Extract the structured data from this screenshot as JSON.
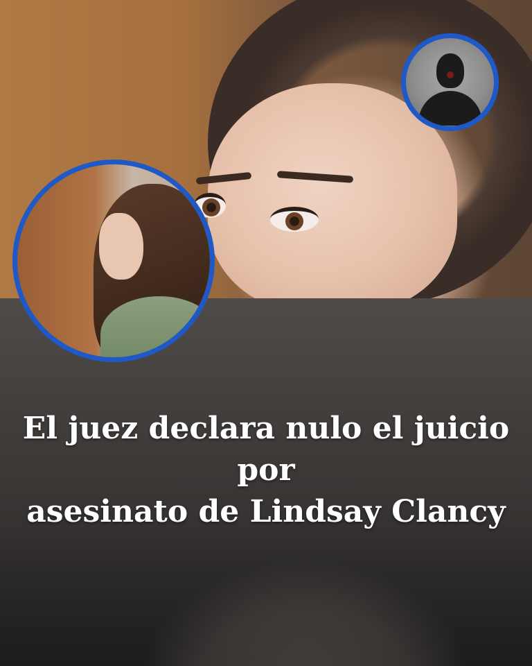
{
  "headline": {
    "line1": "El juez declara nulo el juicio por",
    "line2": "asesinato de Lindsay Clancy"
  },
  "colors": {
    "circle_border": "#1f58c7",
    "headline_text": "#ffffff"
  },
  "icons": {
    "placeholder_avatar": "person-silhouette-icon"
  }
}
